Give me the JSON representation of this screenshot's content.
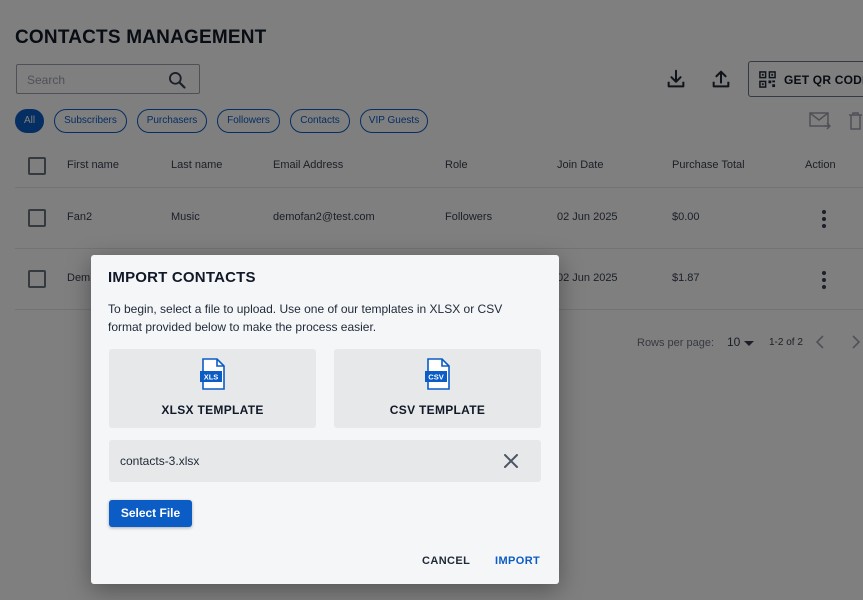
{
  "page": {
    "title": "CONTACTS MANAGEMENT"
  },
  "search": {
    "placeholder": "Search"
  },
  "toolbar": {
    "download_icon": "download-icon",
    "upload_icon": "upload-icon",
    "qr_label": "GET QR CODE",
    "qr_icon": "qr-code-icon"
  },
  "filters": [
    {
      "label": "All",
      "active": true
    },
    {
      "label": "Subscribers",
      "active": false
    },
    {
      "label": "Purchasers",
      "active": false
    },
    {
      "label": "Followers",
      "active": false
    },
    {
      "label": "Contacts",
      "active": false
    },
    {
      "label": "VIP Guests",
      "active": false
    }
  ],
  "table": {
    "headers": [
      "First name",
      "Last name",
      "Email Address",
      "Role",
      "Join Date",
      "Purchase Total",
      "Action"
    ],
    "rows": [
      {
        "first": "Fan2",
        "last": "Music",
        "email": "demofan2@test.com",
        "role": "Followers",
        "join": "02 Jun 2025",
        "total": "$0.00"
      },
      {
        "first": "Dem",
        "last": "",
        "email": "",
        "role": "",
        "join": "02 Jun 2025",
        "total": "$1.87"
      }
    ]
  },
  "pagination": {
    "rows_label": "Rows per page:",
    "rows_value": "10",
    "range": "1-2 of 2"
  },
  "dialog": {
    "title": "IMPORT CONTACTS",
    "description": "To begin, select a file to upload. Use one of our templates in XLSX or CSV format provided below to make the process easier.",
    "templates": [
      {
        "label": "XLSX TEMPLATE",
        "badge": "XLS",
        "icon": "xls-file-icon"
      },
      {
        "label": "CSV TEMPLATE",
        "badge": "CSV",
        "icon": "csv-file-icon"
      }
    ],
    "file_name": "contacts-3.xlsx",
    "select_label": "Select File",
    "cancel_label": "CANCEL",
    "import_label": "IMPORT"
  },
  "colors": {
    "primary": "#0b5cc4",
    "overlay": "rgba(0,0,0,0.5)"
  }
}
